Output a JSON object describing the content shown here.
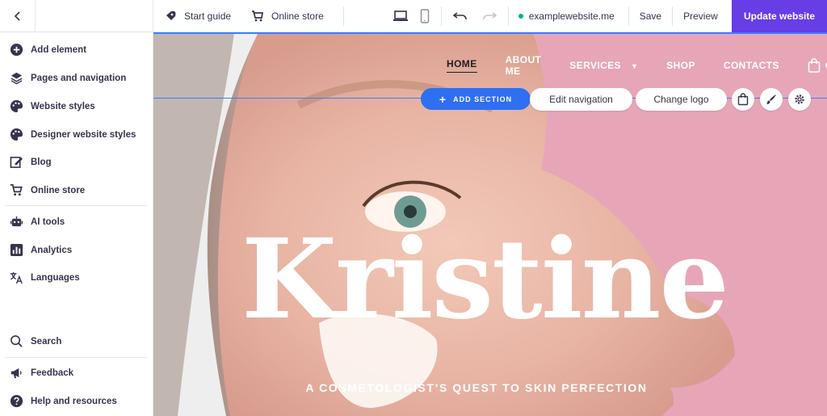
{
  "topbar": {
    "start_guide": "Start guide",
    "online_store": "Online store",
    "domain": "examplewebsite.me",
    "save": "Save",
    "preview": "Preview",
    "update": "Update website"
  },
  "sidebar": {
    "items": [
      {
        "label": "Add element",
        "icon": "plus-circle-icon"
      },
      {
        "label": "Pages and navigation",
        "icon": "layers-icon"
      },
      {
        "label": "Website styles",
        "icon": "palette-icon"
      },
      {
        "label": "Designer website styles",
        "icon": "palette-icon"
      },
      {
        "label": "Blog",
        "icon": "edit-icon"
      },
      {
        "label": "Online store",
        "icon": "cart-icon"
      },
      {
        "label": "AI tools",
        "icon": "robot-icon"
      },
      {
        "label": "Analytics",
        "icon": "chart-icon"
      },
      {
        "label": "Languages",
        "icon": "translate-icon"
      }
    ],
    "bottom": [
      {
        "label": "Search",
        "icon": "search-icon"
      },
      {
        "label": "Feedback",
        "icon": "megaphone-icon"
      },
      {
        "label": "Help and resources",
        "icon": "help-icon"
      }
    ]
  },
  "site": {
    "nav": [
      "HOME",
      "ABOUT ME",
      "SERVICES",
      "SHOP",
      "CONTACTS",
      "CA"
    ],
    "add_section": "ADD SECTION",
    "edit_navigation": "Edit navigation",
    "change_logo": "Change logo",
    "headline": "Kristine",
    "tagline": "A COSMETOLOGIST’S QUEST TO SKIN PERFECTION"
  },
  "colors": {
    "accent": "#673de6",
    "edit_blue": "#2f6ff2",
    "hero_pink": "#e4a1b5"
  }
}
